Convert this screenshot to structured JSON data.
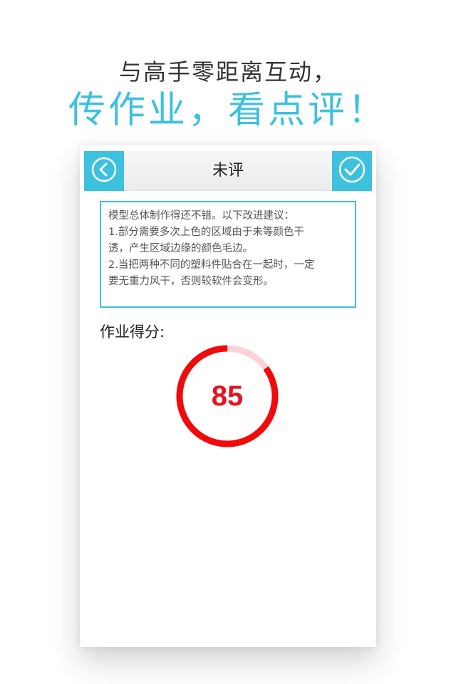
{
  "promo": {
    "line1": "与高手零距离互动，",
    "line2": "传作业，看点评！"
  },
  "header": {
    "title": "未评",
    "back_icon": "chevron-left-circle-icon",
    "done_icon": "check-circle-icon",
    "accent_color": "#3ec0df"
  },
  "comment": {
    "lines": [
      "模型总体制作得还不错。以下改进建议：",
      "1.部分需要多次上色的区域由于未等颜色干",
      "透，产生区域边缘的颜色毛边。",
      "2.当把两种不同的塑料件贴合在一起时，一定",
      "要无重力风干，否则较软件会变形。"
    ]
  },
  "score": {
    "label": "作业得分:",
    "value": "85",
    "max": 100,
    "ring_color": "#f00a0a",
    "track_color": "#fbd3d6"
  }
}
